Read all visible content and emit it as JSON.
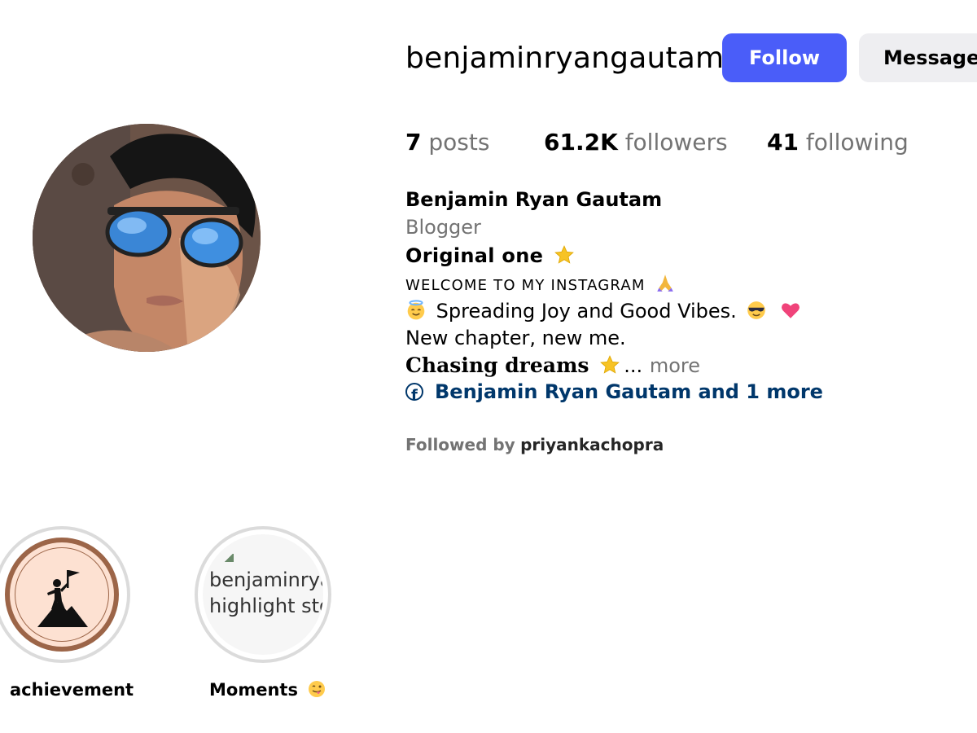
{
  "profile": {
    "username": "benjaminryangautam",
    "follow_label": "Follow",
    "message_label": "Message",
    "avatar_alt": "profile-photo"
  },
  "stats": {
    "posts_count": "7",
    "posts_label": "posts",
    "followers_count": "61.2K",
    "followers_label": "followers",
    "following_count": "41",
    "following_label": "following"
  },
  "bio": {
    "full_name": "Benjamin Ryan Gautam",
    "category": "Blogger",
    "line1": "Original one",
    "line2": "WELCOME TO MY INSTAGRAM",
    "line3": "Spreading Joy and Good Vibes.",
    "line4": "New chapter, new me.",
    "line5": "Chasing dreams",
    "ellipsis": "...",
    "more": "more",
    "link_text": "Benjamin Ryan Gautam and 1 more",
    "emoji": {
      "star": "star-emoji",
      "pray": "folded-hands-emoji",
      "halo": "smiling-face-with-halo-emoji",
      "sunglasses": "smiling-face-with-sunglasses-emoji",
      "heart": "heart-emoji"
    }
  },
  "followed_by": {
    "prefix": "Followed by",
    "user": "priyankachopra"
  },
  "highlights": [
    {
      "label": "achievement",
      "icon": "climber-flag-icon"
    },
    {
      "label": "Moments",
      "alt_line1": "benjaminrya",
      "alt_line2": "highlight sto",
      "emoji": "winking-tongue-emoji"
    }
  ],
  "colors": {
    "accent": "#4a5df9",
    "link": "#00376b",
    "muted": "#737373"
  }
}
